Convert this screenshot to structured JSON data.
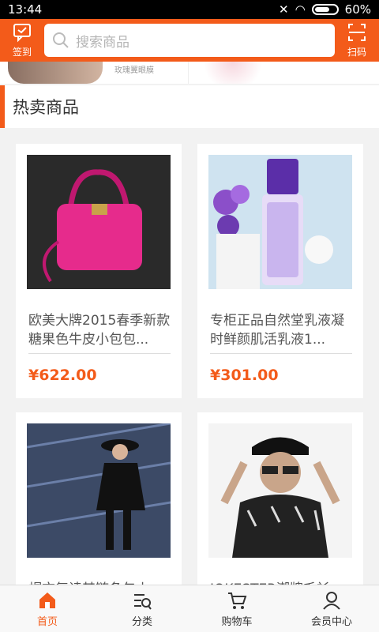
{
  "status_bar": {
    "time": "13:44",
    "battery": "60%"
  },
  "header": {
    "checkin_label": "签到",
    "search_placeholder": "搜索商品",
    "scan_label": "扫码"
  },
  "banner": {
    "caption": "玫瑰翼眼膜"
  },
  "section": {
    "title": "热卖商品"
  },
  "products": [
    {
      "name": "欧美大牌2015春季新款糖果色牛皮小包包...",
      "price": "¥622.00",
      "image_icon": "pink-handbag"
    },
    {
      "name": "专柜正品自然堂乳液凝时鲜颜肌活乳液1...",
      "price": "¥301.00",
      "image_icon": "lotion-bottle"
    },
    {
      "name": "帽衣复读其链条包小",
      "price": "",
      "image_icon": "woman-black-outfit"
    },
    {
      "name": "JOKESTER潮牌毛衫",
      "price": "",
      "image_icon": "man-cap-sunglasses"
    }
  ],
  "nav": [
    {
      "label": "首页",
      "icon": "home-icon",
      "active": true
    },
    {
      "label": "分类",
      "icon": "category-icon",
      "active": false
    },
    {
      "label": "购物车",
      "icon": "cart-icon",
      "active": false
    },
    {
      "label": "会员中心",
      "icon": "user-icon",
      "active": false
    }
  ],
  "colors": {
    "accent": "#f35b1a",
    "background": "#f2f2f2"
  }
}
